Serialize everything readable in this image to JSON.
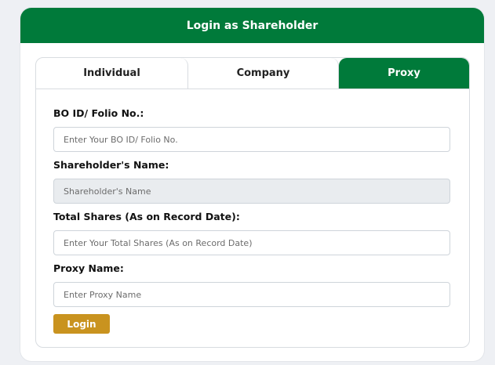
{
  "header": {
    "title": "Login as Shareholder"
  },
  "tabs": [
    {
      "label": "Individual",
      "active": false
    },
    {
      "label": "Company",
      "active": false
    },
    {
      "label": "Proxy",
      "active": true
    }
  ],
  "form": {
    "bo_id": {
      "label": "BO ID/ Folio No.:",
      "placeholder": "Enter Your BO ID/ Folio No.",
      "value": ""
    },
    "shareholder_name": {
      "label": "Shareholder's Name:",
      "placeholder": "Shareholder's Name",
      "value": "",
      "disabled": true
    },
    "total_shares": {
      "label": "Total Shares (As on Record Date):",
      "placeholder": "Enter Your Total Shares (As on Record Date)",
      "value": ""
    },
    "proxy_name": {
      "label": "Proxy Name:",
      "placeholder": "Enter Proxy Name",
      "value": ""
    },
    "login_label": "Login"
  },
  "colors": {
    "brand_green": "#007a3a",
    "login_button": "#c9931f",
    "disabled_input": "#e9ecef"
  }
}
